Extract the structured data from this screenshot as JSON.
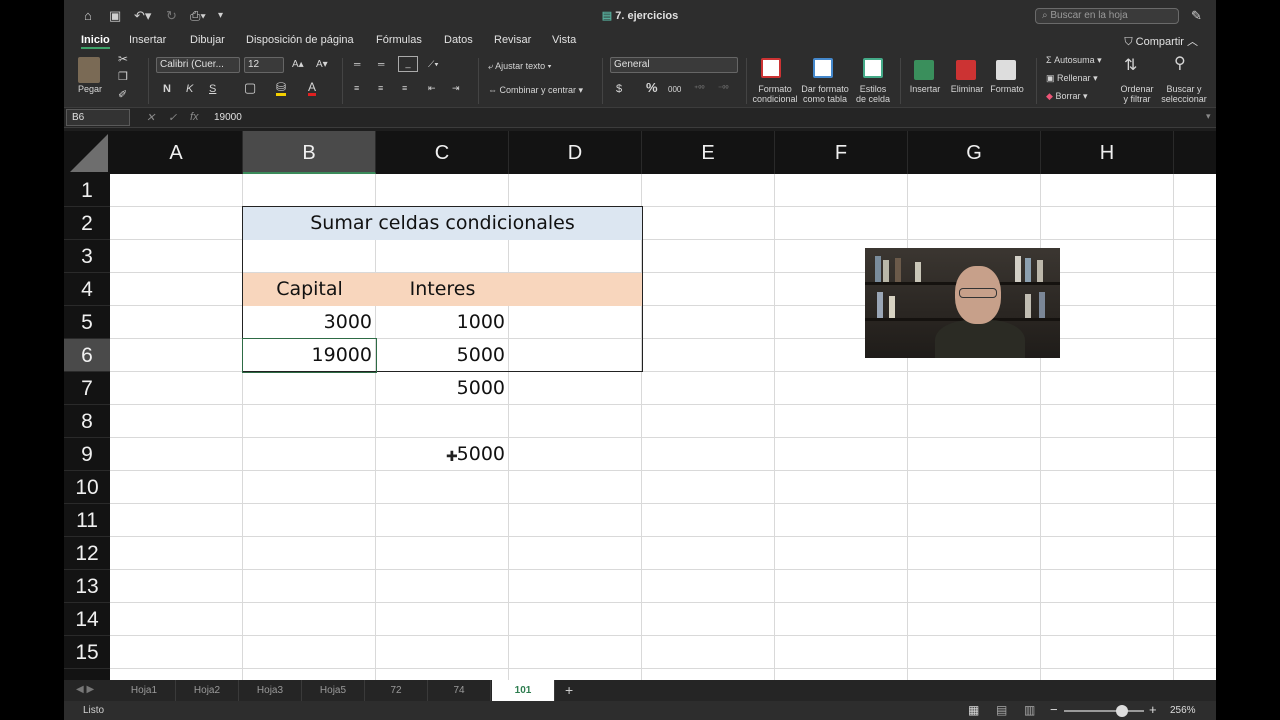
{
  "title_bar": {
    "document_title": "7. ejercicios",
    "search_placeholder": "Buscar en la hoja"
  },
  "ribbon": {
    "tabs": [
      {
        "label": "Inicio",
        "active": true
      },
      {
        "label": "Insertar"
      },
      {
        "label": "Dibujar"
      },
      {
        "label": "Disposición de página"
      },
      {
        "label": "Fórmulas"
      },
      {
        "label": "Datos"
      },
      {
        "label": "Revisar"
      },
      {
        "label": "Vista"
      }
    ],
    "share_label": "Compartir",
    "paste_label": "Pegar",
    "font_name": "Calibri (Cuer...",
    "font_size": "12",
    "bold": "N",
    "italic": "K",
    "underline": "S",
    "wrap_text": "Ajustar texto",
    "merge_center": "Combinar y centrar",
    "number_format": "General",
    "currency": "$",
    "percent": "%",
    "thousands": "000",
    "conditional_format": "Formato\ncondicional",
    "format_as_table": "Dar formato\ncomo tabla",
    "cell_styles": "Estilos\nde celda",
    "insert": "Insertar",
    "delete": "Eliminar",
    "format": "Formato",
    "autosum": "Autosuma",
    "fill": "Rellenar",
    "clear": "Borrar",
    "sort_filter": "Ordenar\ny filtrar",
    "find_select": "Buscar y\nseleccionar"
  },
  "formula_bar": {
    "name_box": "B6",
    "formula": "19000"
  },
  "columns": [
    "A",
    "B",
    "C",
    "D",
    "E",
    "F",
    "G",
    "H"
  ],
  "rows": [
    "1",
    "2",
    "3",
    "4",
    "5",
    "6",
    "7",
    "8",
    "9",
    "10",
    "11",
    "12",
    "13",
    "14",
    "15"
  ],
  "sheet": {
    "title": "Sumar celdas condicionales",
    "headers": {
      "capital": "Capital",
      "interes": "Interes"
    },
    "B5": "3000",
    "C5": "1000",
    "B6": "19000",
    "C6": "5000",
    "C7": "5000",
    "C9": "5000"
  },
  "sheet_tabs": [
    {
      "label": "Hoja1"
    },
    {
      "label": "Hoja2"
    },
    {
      "label": "Hoja3"
    },
    {
      "label": "Hoja5"
    },
    {
      "label": "72"
    },
    {
      "label": "74"
    },
    {
      "label": "101",
      "active": true
    }
  ],
  "status": {
    "mode": "Listo",
    "zoom": "256%"
  },
  "colors": {
    "accent_green": "#2e7d4f",
    "title_band": "#dce6f1",
    "header_band": "#f8d6bd"
  }
}
